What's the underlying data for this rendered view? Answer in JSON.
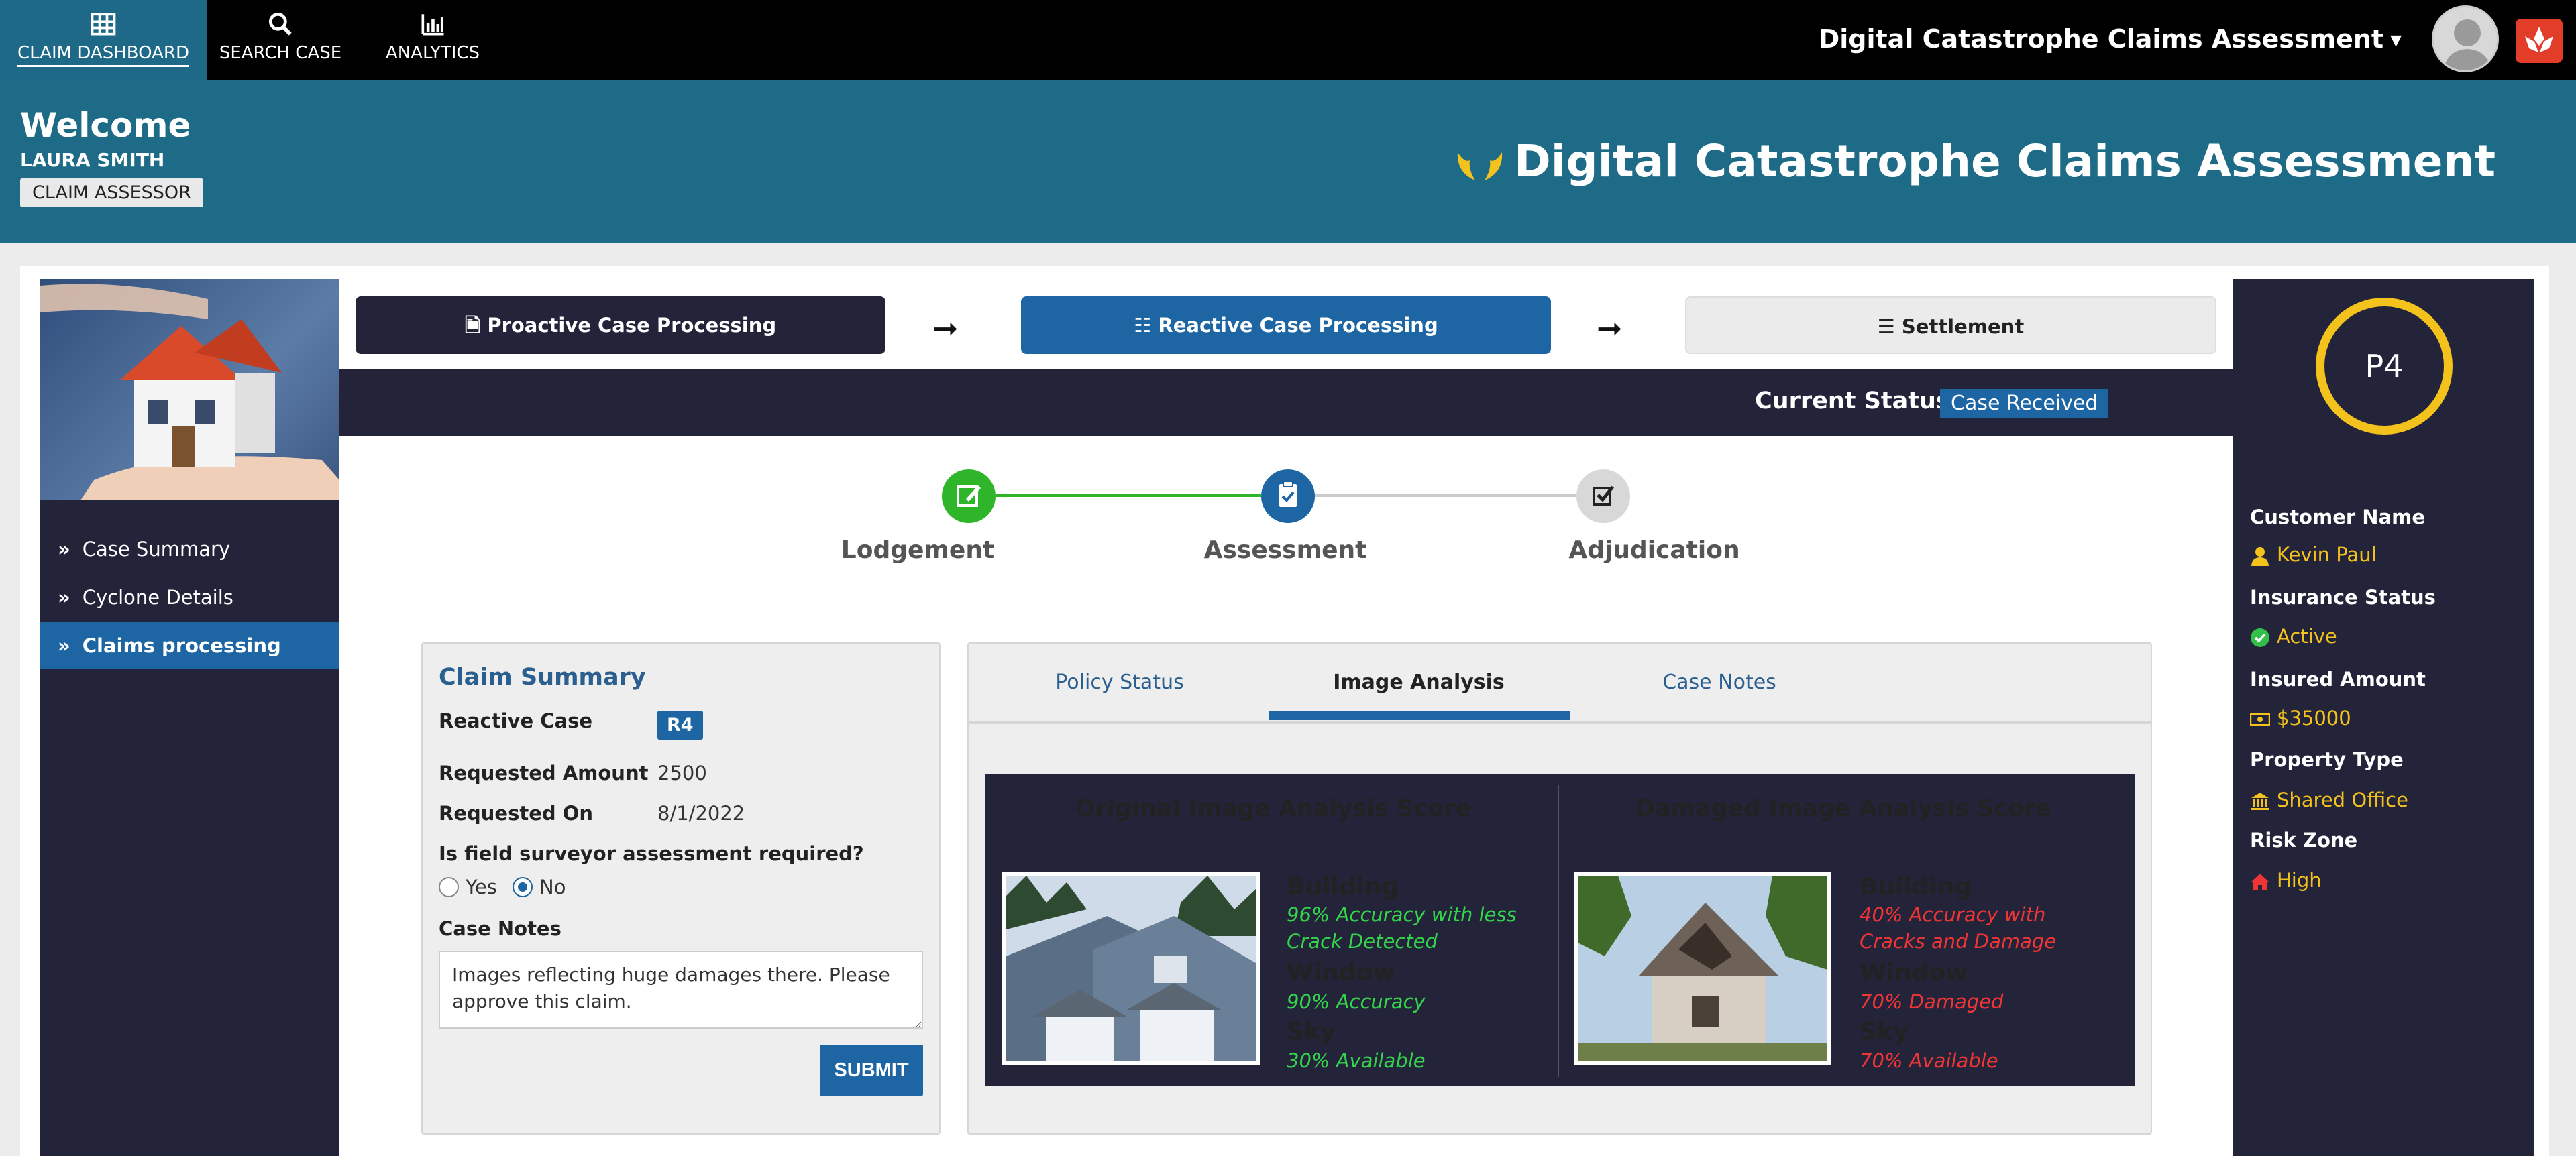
{
  "nav": {
    "items": [
      {
        "label": "CLAIM DASHBOARD",
        "icon": "dashboard-icon",
        "active": true
      },
      {
        "label": "SEARCH CASE",
        "icon": "search-icon",
        "active": false
      },
      {
        "label": "ANALYTICS",
        "icon": "bar-chart-icon",
        "active": false
      }
    ],
    "app_menu_label": "Digital Catastrophe Claims Assessment"
  },
  "header": {
    "welcome": "Welcome",
    "user": "LAURA SMITH",
    "role": "CLAIM ASSESSOR",
    "title": "Digital Catastrophe Claims Assessment"
  },
  "sidebar": {
    "items": [
      {
        "label": "Case Summary",
        "active": false
      },
      {
        "label": "Cyclone Details",
        "active": false
      },
      {
        "label": "Claims processing",
        "active": true
      }
    ]
  },
  "process": {
    "steps": [
      {
        "label": "Proactive Case Processing",
        "icon": "document-icon"
      },
      {
        "label": "Reactive Case Processing",
        "icon": "checklist-icon"
      },
      {
        "label": "Settlement",
        "icon": "list-icon"
      }
    ],
    "status_label": "Current Status",
    "status_value": "Case Received"
  },
  "timeline": {
    "stages": [
      {
        "label": "Lodgement",
        "state": "done"
      },
      {
        "label": "Assessment",
        "state": "current"
      },
      {
        "label": "Adjudication",
        "state": "pending"
      }
    ]
  },
  "claim_summary": {
    "title": "Claim Summary",
    "case_label": "Reactive Case",
    "case_badge": "R4",
    "amount_label": "Requested Amount",
    "amount_value": "2500",
    "date_label": "Requested On",
    "date_value": "8/1/2022",
    "question": "Is field surveyor assessment required?",
    "yes_label": "Yes",
    "no_label": "No",
    "selected": "No",
    "notes_label": "Case Notes",
    "notes_value": "Images reflecting huge damages there. Please approve this claim.",
    "submit_label": "SUBMIT"
  },
  "analysis": {
    "tabs": [
      {
        "label": "Policy Status",
        "active": false
      },
      {
        "label": "Image Analysis",
        "active": true
      },
      {
        "label": "Case Notes",
        "active": false
      }
    ],
    "original": {
      "heading": "Original Image Analysis Score",
      "metrics": [
        {
          "name": "Building",
          "value": "96% Accuracy with less Crack Detected"
        },
        {
          "name": "Window",
          "value": "90% Accuracy"
        },
        {
          "name": "Sky",
          "value": "30% Available"
        }
      ]
    },
    "damaged": {
      "heading": "Damaged Image Analysis Score",
      "metrics": [
        {
          "name": "Building",
          "value": "40% Accuracy with Cracks and Damage"
        },
        {
          "name": "Window",
          "value": "70% Damaged"
        },
        {
          "name": "Sky",
          "value": "70% Available"
        }
      ]
    }
  },
  "customer": {
    "priority": "P4",
    "name_label": "Customer Name",
    "name_value": "Kevin Paul",
    "status_label": "Insurance Status",
    "status_value": "Active",
    "amount_label": "Insured Amount",
    "amount_value": "$35000",
    "property_label": "Property Type",
    "property_value": "Shared Office",
    "risk_label": "Risk Zone",
    "risk_value": "High"
  },
  "colors": {
    "nav_bg": "#000000",
    "header_bg": "#1e6b87",
    "dark_panel": "#23233a",
    "accent_blue": "#1d66a3",
    "gold": "#f4c21c",
    "good_green": "#33d64a",
    "bad_red": "#f03535"
  }
}
